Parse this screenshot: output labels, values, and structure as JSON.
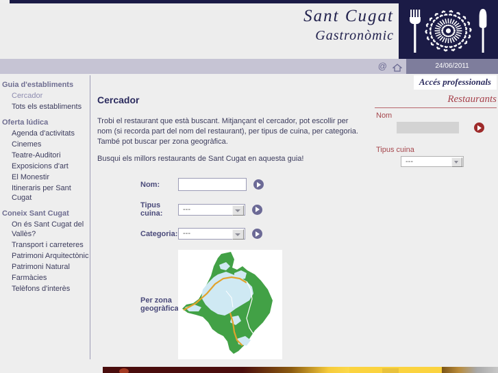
{
  "site": {
    "title_line1": "Sant Cugat",
    "title_line2": "Gastronòmic",
    "logo_icons": [
      "fork-icon",
      "rosette-icon",
      "knife-icon"
    ]
  },
  "navbar": {
    "mail_icon": "@",
    "home_icon": "home-icon",
    "date": "24/06/2011"
  },
  "sidebar": {
    "groups": [
      {
        "heading": "Guia d'establiments",
        "items": [
          {
            "label": "Cercador",
            "active": true
          },
          {
            "label": "Tots els establiments",
            "active": false
          }
        ]
      },
      {
        "heading": "Oferta lúdica",
        "items": [
          {
            "label": "Agenda d'activitats",
            "active": false
          },
          {
            "label": "Cinemes",
            "active": false
          },
          {
            "label": "Teatre-Auditori",
            "active": false
          },
          {
            "label": "Exposicions d'art",
            "active": false
          },
          {
            "label": "El Monestir",
            "active": false
          },
          {
            "label": "Itineraris per Sant Cugat",
            "active": false
          }
        ]
      },
      {
        "heading": "Coneix Sant Cugat",
        "items": [
          {
            "label": "On és Sant Cugat del Vallès?",
            "active": false
          },
          {
            "label": "Transport i carreteres",
            "active": false
          },
          {
            "label": "Patrimoni Arquitectònic",
            "active": false
          },
          {
            "label": "Patrimoni Natural",
            "active": false
          },
          {
            "label": "Farmàcies",
            "active": false
          },
          {
            "label": "Telèfons d'interès",
            "active": false
          }
        ]
      }
    ]
  },
  "content": {
    "page_title": "Cercador",
    "paragraphs": [
      "Trobi el restaurant que està buscant.\nMitjançant el cercador, pot escollir per nom (si recorda part del nom del restaurant), per tipus de cuina, per categoria.\nTambé pot buscar per zona geogràfica.",
      "Busqui els millors restaurants de Sant Cugat en aquesta guia!"
    ],
    "form": {
      "nom": {
        "label": "Nom:",
        "value": "",
        "placeholder": "",
        "go_icon": "play-arrow-icon"
      },
      "tipus_cuina": {
        "label": "Tipus cuina:",
        "value": "---",
        "go_icon": "play-arrow-icon"
      },
      "categoria": {
        "label": "Categoria:",
        "value": "---",
        "go_icon": "play-arrow-icon"
      },
      "zona": {
        "label": "Per zona geogràfica:",
        "map_alt": "map-of-sant-cugat"
      }
    }
  },
  "right_panel": {
    "acces_label": "Accés professionals",
    "heading": "Restaurants",
    "nom": {
      "label": "Nom",
      "value": "",
      "go_icon": "play-arrow-icon"
    },
    "tipus_cuina": {
      "label": "Tipus cuina",
      "value": "---"
    }
  },
  "colors": {
    "navy": "#1b1b46",
    "lavender_bar": "#c6c4d4",
    "date_bg": "#7e7d9c",
    "purple_accent": "#6c6a96",
    "maroon_accent": "#a5464c",
    "page_bg": "#eeeeee",
    "map_green": "#42a146",
    "map_blue": "#cfe9f3"
  }
}
